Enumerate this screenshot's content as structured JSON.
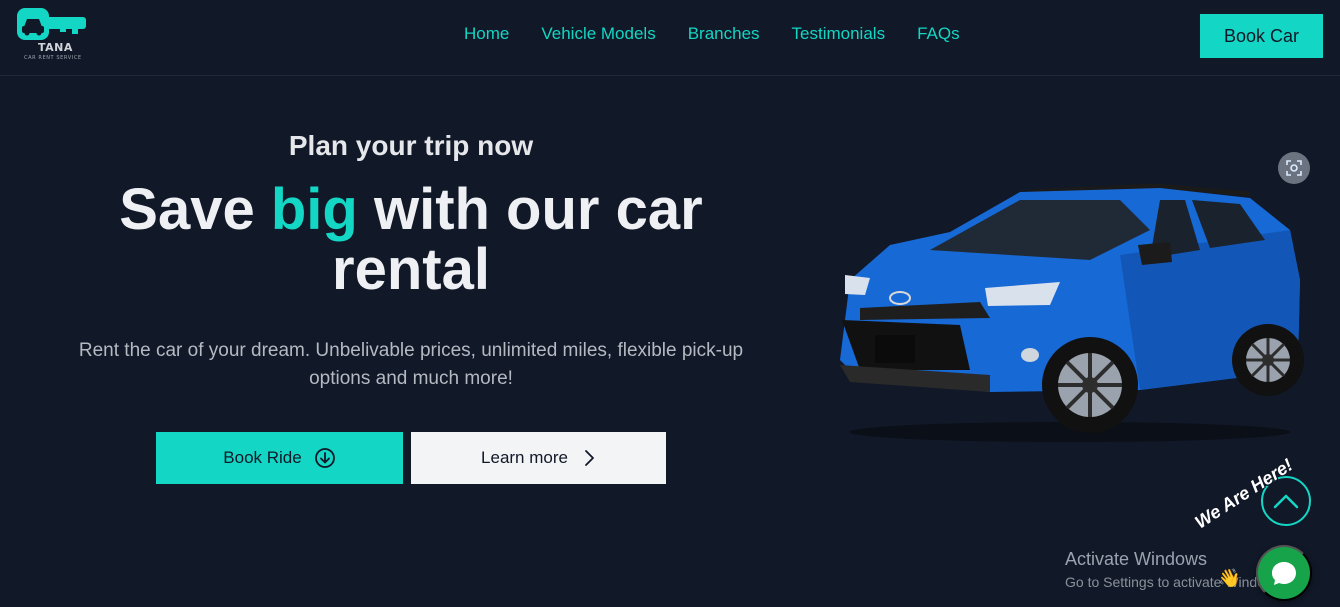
{
  "brand": {
    "name": "TANA",
    "tagline": "CAR RENT SERVICE",
    "accent_color": "#14d6c4",
    "background_color": "#111827"
  },
  "nav": {
    "links": [
      "Home",
      "Vehicle Models",
      "Branches",
      "Testimonials",
      "FAQs"
    ],
    "cta_label": "Book Car"
  },
  "hero": {
    "kicker": "Plan your trip now",
    "title_before": "Save ",
    "title_accent": "big",
    "title_after": " with our car rental",
    "description": "Rent the car of your dream. Unbelivable prices, unlimited miles, flexible pick-up options and much more!",
    "primary_button": "Book Ride",
    "primary_icon": "circle-arrow-down-icon",
    "secondary_button": "Learn more",
    "secondary_icon": "chevron-right-icon"
  },
  "image": {
    "subject": "blue-suv-car",
    "overlay_icon": "visual-search-icon"
  },
  "widgets": {
    "scroll_icon": "chevron-up-icon",
    "chat_badge": "We Are Here!",
    "chat_icon": "chat-bubble-icon",
    "wave_icon": "waving-hand-icon"
  },
  "os_watermark": {
    "title": "Activate Windows",
    "subtitle": "Go to Settings to activate Windows."
  }
}
